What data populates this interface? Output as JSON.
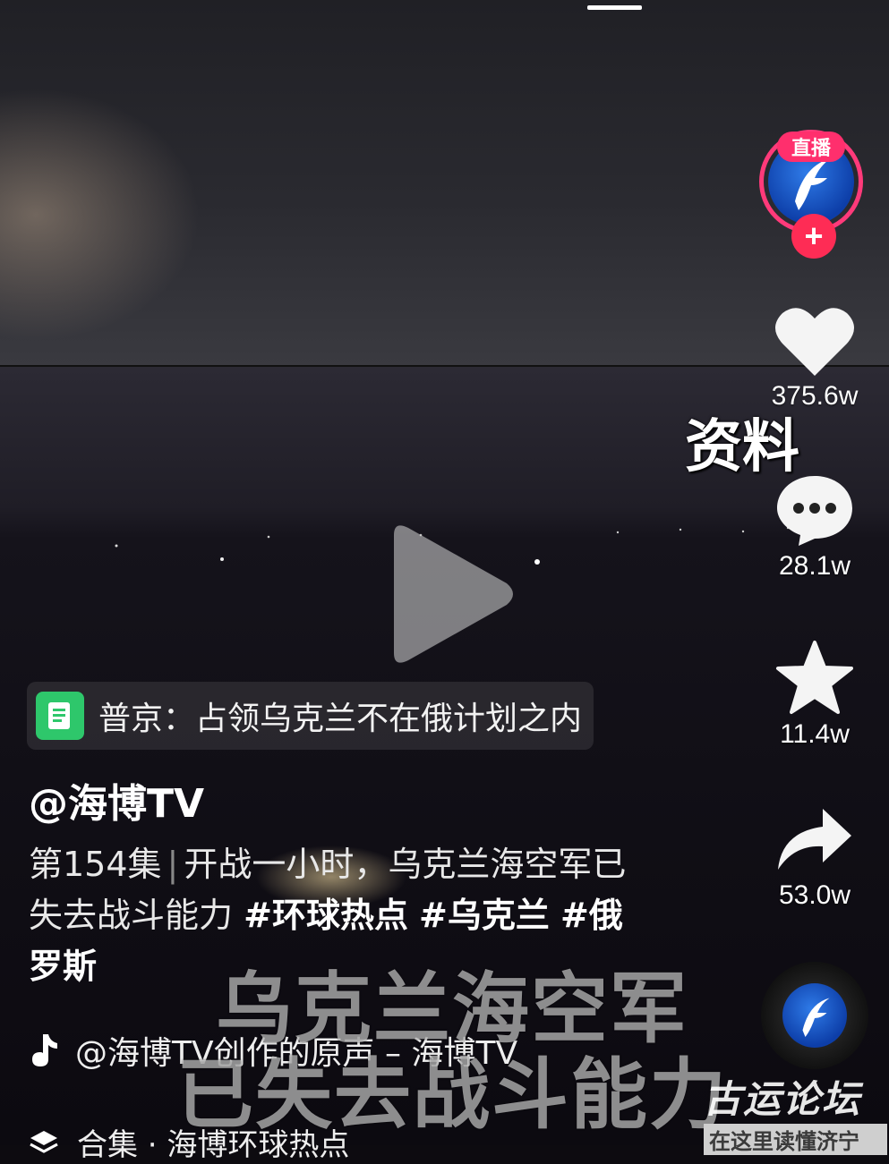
{
  "video": {
    "overlay_caption": "资料",
    "subtitle_lines": [
      "乌克兰海空军",
      "已失去战斗能力"
    ]
  },
  "rail": {
    "live_badge": "直播",
    "like_count": "375.6w",
    "comment_count": "28.1w",
    "favorite_count": "11.4w",
    "share_count": "53.0w"
  },
  "topic": {
    "text": "普京：占领乌克兰不在俄计划之内"
  },
  "post": {
    "author": "@海博TV",
    "episode": "第154集",
    "caption_main": "开战一小时，乌克兰海空军已失去战斗能力",
    "tags": [
      "#环球热点",
      "#乌克兰",
      "#俄罗斯"
    ]
  },
  "music": {
    "text": "@海博TV创作的原声 – 海博TV"
  },
  "collection": {
    "text": "合集 · 海博环球热点"
  },
  "watermark": {
    "line1": "古运论坛",
    "line2": "在这里读懂济宁"
  },
  "colors": {
    "live_ring": "#ff3a7a",
    "follow_plus": "#fe2c55",
    "topic_icon": "#2ec76b"
  }
}
